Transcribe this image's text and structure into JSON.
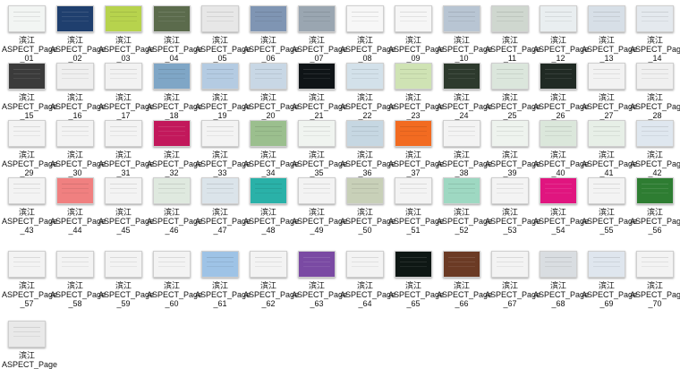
{
  "files": [
    {
      "line1": "滨江",
      "line2": "ASPECT_Page",
      "line3": "_01",
      "color": "#f2f5f3"
    },
    {
      "line1": "滨江",
      "line2": "ASPECT_Page",
      "line3": "_02",
      "color": "#1f3f6e"
    },
    {
      "line1": "滨江",
      "line2": "ASPECT_Page",
      "line3": "_03",
      "color": "#b7d34d"
    },
    {
      "line1": "滨江",
      "line2": "ASPECT_Page",
      "line3": "_04",
      "color": "#5b6b4c"
    },
    {
      "line1": "滨江",
      "line2": "ASPECT_Page",
      "line3": "_05",
      "color": "#e7e7e7"
    },
    {
      "line1": "滨江",
      "line2": "ASPECT_Page",
      "line3": "_06",
      "color": "#7f95b3"
    },
    {
      "line1": "滨江",
      "line2": "ASPECT_Page",
      "line3": "_07",
      "color": "#9aa6b1"
    },
    {
      "line1": "滨江",
      "line2": "ASPECT_Page",
      "line3": "_08",
      "color": "#f7f7f7"
    },
    {
      "line1": "滨江",
      "line2": "ASPECT_Page",
      "line3": "_09",
      "color": "#f6f6f6"
    },
    {
      "line1": "滨江",
      "line2": "ASPECT_Page",
      "line3": "_10",
      "color": "#b8c5d3"
    },
    {
      "line1": "滨江",
      "line2": "ASPECT_Page",
      "line3": "_11",
      "color": "#cfd7cf"
    },
    {
      "line1": "滨江",
      "line2": "ASPECT_Page",
      "line3": "_12",
      "color": "#e9eef0"
    },
    {
      "line1": "滨江",
      "line2": "ASPECT_Page",
      "line3": "_13",
      "color": "#d7dfe7"
    },
    {
      "line1": "滨江",
      "line2": "ASPECT_Page",
      "line3": "_14",
      "color": "#e4e9ee"
    },
    {
      "line1": "滨江",
      "line2": "ASPECT_Page",
      "line3": "_15",
      "color": "#3b3b3b"
    },
    {
      "line1": "滨江",
      "line2": "ASPECT_Page",
      "line3": "_16",
      "color": "#efefef"
    },
    {
      "line1": "滨江",
      "line2": "ASPECT_Page",
      "line3": "_17",
      "color": "#f2f2f2"
    },
    {
      "line1": "滨江",
      "line2": "ASPECT_Page",
      "line3": "_18",
      "color": "#7fa6c6"
    },
    {
      "line1": "滨江",
      "line2": "ASPECT_Page",
      "line3": "_19",
      "color": "#b4cbe2"
    },
    {
      "line1": "滨江",
      "line2": "ASPECT_Page",
      "line3": "_20",
      "color": "#c8d7e5"
    },
    {
      "line1": "滨江",
      "line2": "ASPECT_Page",
      "line3": "_21",
      "color": "#0f1417"
    },
    {
      "line1": "滨江",
      "line2": "ASPECT_Page",
      "line3": "_22",
      "color": "#d3e1ea"
    },
    {
      "line1": "滨江",
      "line2": "ASPECT_Page",
      "line3": "_23",
      "color": "#cfe3b4"
    },
    {
      "line1": "滨江",
      "line2": "ASPECT_Page",
      "line3": "_24",
      "color": "#2d3a2d"
    },
    {
      "line1": "滨江",
      "line2": "ASPECT_Page",
      "line3": "_25",
      "color": "#dbe6dc"
    },
    {
      "line1": "滨江",
      "line2": "ASPECT_Page",
      "line3": "_26",
      "color": "#202a24"
    },
    {
      "line1": "滨江",
      "line2": "ASPECT_Page",
      "line3": "_27",
      "color": "#f2f2f2"
    },
    {
      "line1": "滨江",
      "line2": "ASPECT_Page",
      "line3": "_28",
      "color": "#f0f0f0"
    },
    {
      "line1": "滨江",
      "line2": "ASPECT_Page",
      "line3": "_29",
      "color": "#f3f3f3"
    },
    {
      "line1": "滨江",
      "line2": "ASPECT_Page",
      "line3": "_30",
      "color": "#f3f3f3"
    },
    {
      "line1": "滨江",
      "line2": "ASPECT_Page",
      "line3": "_31",
      "color": "#f3f3f3"
    },
    {
      "line1": "滨江",
      "line2": "ASPECT_Page",
      "line3": "_32",
      "color": "#c2185b"
    },
    {
      "line1": "滨江",
      "line2": "ASPECT_Page",
      "line3": "_33",
      "color": "#f3f3f3"
    },
    {
      "line1": "滨江",
      "line2": "ASPECT_Page",
      "line3": "_34",
      "color": "#9bbf8e"
    },
    {
      "line1": "滨江",
      "line2": "ASPECT_Page",
      "line3": "_35",
      "color": "#f0f4f0"
    },
    {
      "line1": "滨江",
      "line2": "ASPECT_Page",
      "line3": "_36",
      "color": "#c6d7e2"
    },
    {
      "line1": "滨江",
      "line2": "ASPECT_Page",
      "line3": "_37",
      "color": "#f26b21"
    },
    {
      "line1": "滨江",
      "line2": "ASPECT_Page",
      "line3": "_38",
      "color": "#f3f3f3"
    },
    {
      "line1": "滨江",
      "line2": "ASPECT_Page",
      "line3": "_39",
      "color": "#eef3ee"
    },
    {
      "line1": "滨江",
      "line2": "ASPECT_Page",
      "line3": "_40",
      "color": "#dbe7db"
    },
    {
      "line1": "滨江",
      "line2": "ASPECT_Page",
      "line3": "_41",
      "color": "#e7efe7"
    },
    {
      "line1": "滨江",
      "line2": "ASPECT_Page",
      "line3": "_42",
      "color": "#dfe7ef"
    },
    {
      "line1": "滨江",
      "line2": "ASPECT_Page",
      "line3": "_43",
      "color": "#f3f3f3"
    },
    {
      "line1": "滨江",
      "line2": "ASPECT_Page",
      "line3": "_44",
      "color": "#f08080"
    },
    {
      "line1": "滨江",
      "line2": "ASPECT_Page",
      "line3": "_45",
      "color": "#f3f3f3"
    },
    {
      "line1": "滨江",
      "line2": "ASPECT_Page",
      "line3": "_46",
      "color": "#dfe9df"
    },
    {
      "line1": "滨江",
      "line2": "ASPECT_Page",
      "line3": "_47",
      "color": "#dbe4ea"
    },
    {
      "line1": "滨江",
      "line2": "ASPECT_Page",
      "line3": "_48",
      "color": "#2ab1a8"
    },
    {
      "line1": "滨江",
      "line2": "ASPECT_Page",
      "line3": "_49",
      "color": "#f3f3f3"
    },
    {
      "line1": "滨江",
      "line2": "ASPECT_Page",
      "line3": "_50",
      "color": "#c8d0b8"
    },
    {
      "line1": "滨江",
      "line2": "ASPECT_Page",
      "line3": "_51",
      "color": "#f3f3f3"
    },
    {
      "line1": "滨江",
      "line2": "ASPECT_Page",
      "line3": "_52",
      "color": "#9ed8c2"
    },
    {
      "line1": "滨江",
      "line2": "ASPECT_Page",
      "line3": "_53",
      "color": "#f3f3f3"
    },
    {
      "line1": "滨江",
      "line2": "ASPECT_Page",
      "line3": "_54",
      "color": "#e0157f"
    },
    {
      "line1": "滨江",
      "line2": "ASPECT_Page",
      "line3": "_55",
      "color": "#f3f3f3"
    },
    {
      "line1": "滨江",
      "line2": "ASPECT_Page",
      "line3": "_56",
      "color": "#2e7d32"
    },
    {
      "line1": "滨江",
      "line2": "ASPECT_Page",
      "line3": "_57",
      "color": "#f3f3f3"
    },
    {
      "line1": "滨江",
      "line2": "ASPECT_Page",
      "line3": "_58",
      "color": "#f3f3f3"
    },
    {
      "line1": "滨江",
      "line2": "ASPECT_Page",
      "line3": "_59",
      "color": "#f3f3f3"
    },
    {
      "line1": "滨江",
      "line2": "ASPECT_Page",
      "line3": "_60",
      "color": "#f3f3f3"
    },
    {
      "line1": "滨江",
      "line2": "ASPECT_Page",
      "line3": "_61",
      "color": "#9ec3e6"
    },
    {
      "line1": "滨江",
      "line2": "ASPECT_Page",
      "line3": "_62",
      "color": "#f3f3f3"
    },
    {
      "line1": "滨江",
      "line2": "ASPECT_Page",
      "line3": "_63",
      "color": "#7a4aa3"
    },
    {
      "line1": "滨江",
      "line2": "ASPECT_Page",
      "line3": "_64",
      "color": "#f3f3f3"
    },
    {
      "line1": "滨江",
      "line2": "ASPECT_Page",
      "line3": "_65",
      "color": "#0e1714"
    },
    {
      "line1": "滨江",
      "line2": "ASPECT_Page",
      "line3": "_66",
      "color": "#6b3a24"
    },
    {
      "line1": "滨江",
      "line2": "ASPECT_Page",
      "line3": "_67",
      "color": "#f3f3f3"
    },
    {
      "line1": "滨江",
      "line2": "ASPECT_Page",
      "line3": "_68",
      "color": "#d9dde1"
    },
    {
      "line1": "滨江",
      "line2": "ASPECT_Page",
      "line3": "_69",
      "color": "#dfe6ee"
    },
    {
      "line1": "滨江",
      "line2": "ASPECT_Page",
      "line3": "_70",
      "color": "#f3f3f3"
    },
    {
      "line1": "滨江",
      "line2": "ASPECT_Page",
      "line3": "",
      "color": "#e9e9e9"
    }
  ]
}
